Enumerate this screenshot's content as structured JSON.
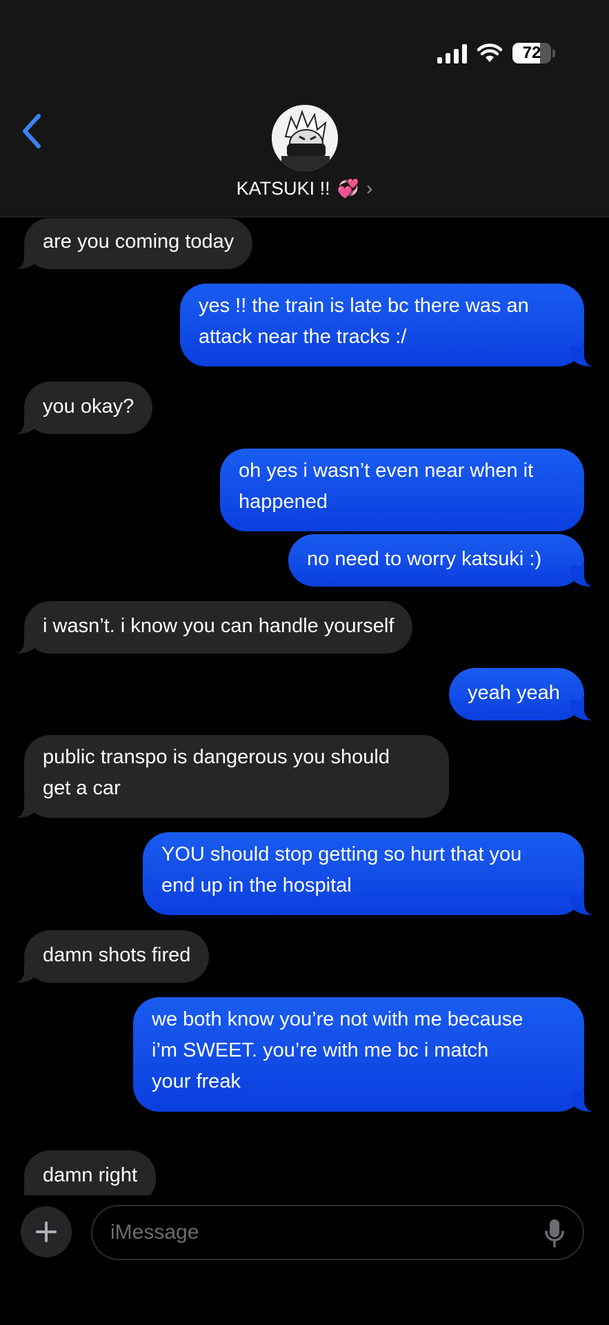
{
  "status": {
    "battery_level": "72",
    "battery_fraction": 0.72
  },
  "contact": {
    "name": "KATSUKI !!",
    "emoji": "💞",
    "chevron": "›"
  },
  "messages": [
    {
      "from": "contact",
      "text": "are you coming today"
    },
    {
      "from": "me",
      "text": "yes !! the train is late bc there was an\nattack near the tracks :/"
    },
    {
      "from": "contact",
      "text": "you okay?"
    },
    {
      "from": "me",
      "text": "oh yes i wasn’t even near when it\nhappened"
    },
    {
      "from": "me",
      "text": "no need to worry katsuki :)"
    },
    {
      "from": "contact",
      "text": "i wasn’t. i know you can handle yourself"
    },
    {
      "from": "me",
      "text": "yeah yeah"
    },
    {
      "from": "contact",
      "text": "public transpo is dangerous you should\nget a car"
    },
    {
      "from": "me",
      "text": "YOU should stop getting so hurt that you\nend up in the hospital"
    },
    {
      "from": "contact",
      "text": "damn shots fired"
    },
    {
      "from": "me",
      "text": "we both know you’re not with me because\ni’m SWEET. you’re with me bc i match\nyour freak"
    },
    {
      "from": "contact",
      "text": "damn right"
    }
  ],
  "composer": {
    "placeholder": "iMessage"
  },
  "colors": {
    "sent_bubble": "#0a3fde",
    "received_bubble": "#262629",
    "accent": "#3b82f6"
  }
}
